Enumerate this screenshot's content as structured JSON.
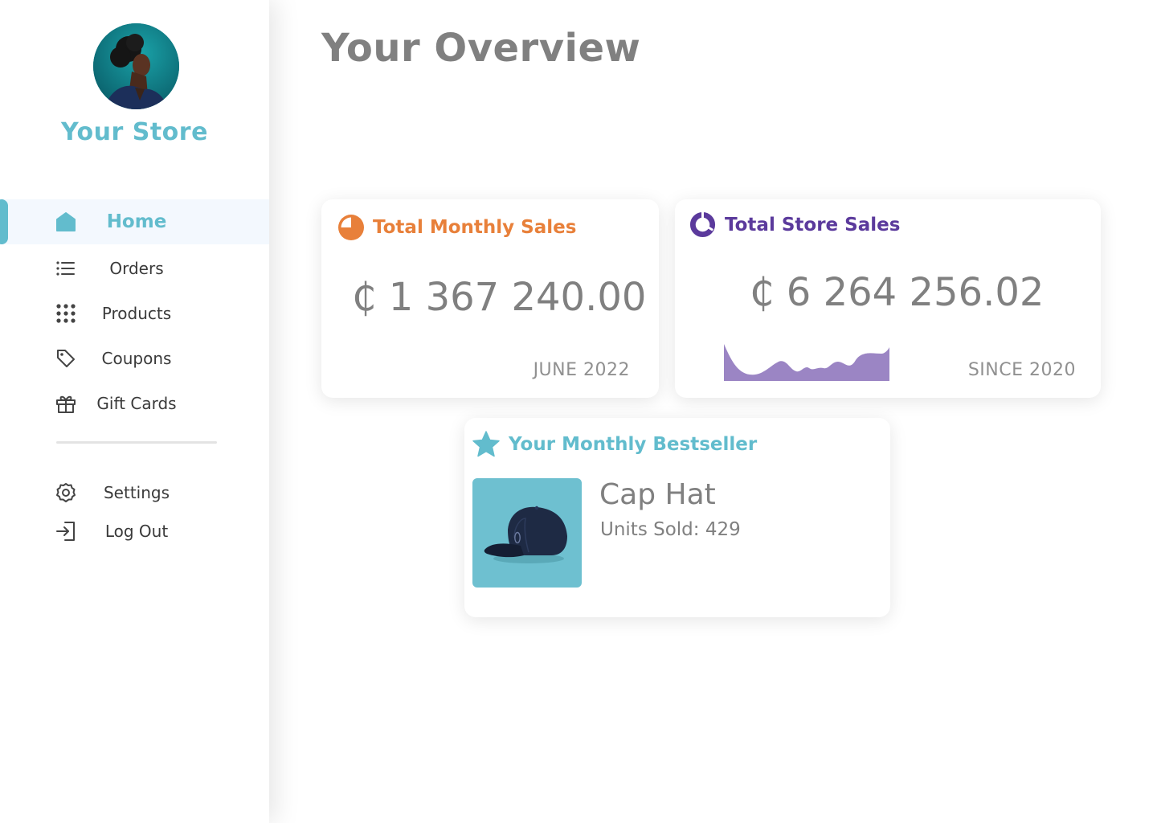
{
  "sidebar": {
    "store_name": "Your Store",
    "nav": [
      {
        "label": "Home",
        "icon": "home-icon",
        "active": true
      },
      {
        "label": "Orders",
        "icon": "list-icon"
      },
      {
        "label": "Products",
        "icon": "grid-icon"
      },
      {
        "label": "Coupons",
        "icon": "tag-icon"
      },
      {
        "label": "Gift Cards",
        "icon": "gift-icon"
      }
    ],
    "secondary": [
      {
        "label": "Settings",
        "icon": "gear-icon"
      },
      {
        "label": "Log Out",
        "icon": "logout-icon"
      }
    ]
  },
  "main": {
    "title": "Your Overview",
    "monthly_sales": {
      "title": "Total Monthly Sales",
      "amount": "₵ 1 367 240.00",
      "period": "JUNE 2022",
      "icon": "pie-chart-icon",
      "color": "#e8803a"
    },
    "store_sales": {
      "title": "Total Store Sales",
      "amount": "₵ 6 264 256.02",
      "period": "SINCE 2020",
      "icon": "donut-chart-icon",
      "color": "#5b3a9c",
      "sparkline_color": "#9b85c4"
    },
    "bestseller": {
      "title": "Your Monthly Bestseller",
      "icon": "star-icon",
      "color": "#62bccd",
      "product_name": "Cap Hat",
      "units_sold": "Units Sold: 429"
    }
  }
}
